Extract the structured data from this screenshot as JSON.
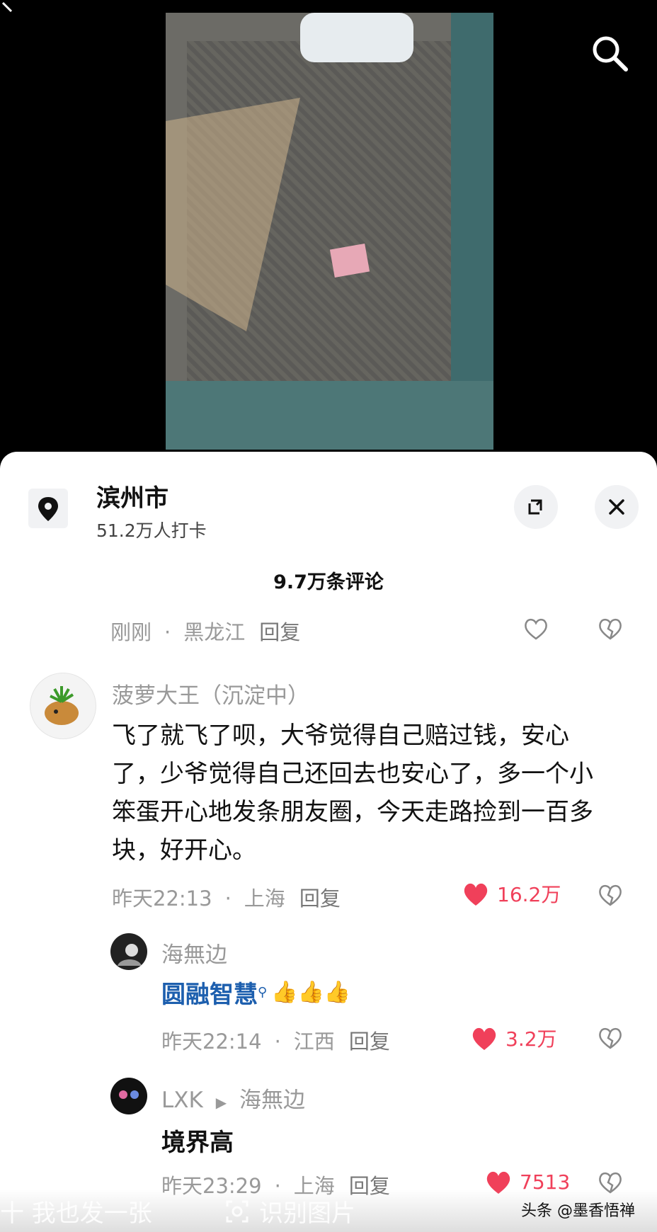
{
  "location": {
    "city": "滨州市",
    "checkins": "51.2万人打卡"
  },
  "comments_count": "9.7万条评论",
  "previous_row": {
    "time": "刚刚",
    "region": "黑龙江",
    "reply": "回复"
  },
  "comments": [
    {
      "name": "菠萝大王（沉淀中）",
      "text": "飞了就飞了呗，大爷觉得自己赔过钱，安心了，少爷觉得自己还回去也安心了，多一个小笨蛋开心地发条朋友圈，今天走路捡到一百多块，好开心。",
      "time": "昨天22:13",
      "region": "上海",
      "reply": "回复",
      "likes": "16.2万"
    },
    {
      "name": "海無边",
      "text": "圆融智慧",
      "time": "昨天22:14",
      "region": "江西",
      "reply": "回复",
      "likes": "3.2万"
    },
    {
      "name": "LXK",
      "reply_to": "海無边",
      "text": "境界高",
      "time": "昨天23:29",
      "region": "上海",
      "reply": "回复",
      "likes": "7513"
    }
  ],
  "bottom": {
    "share": "十 我也发一张",
    "identify": "识别图片",
    "watermark": "头条 @墨香悟禅"
  },
  "colors": {
    "like_red": "#f0405a",
    "link_blue": "#1d5fae"
  },
  "icons": [
    "back-icon",
    "search-icon",
    "location-pin-icon",
    "expand-icon",
    "close-icon",
    "heart-icon",
    "dislike-heart-icon",
    "thumbs-up-icon",
    "scan-icon"
  ]
}
